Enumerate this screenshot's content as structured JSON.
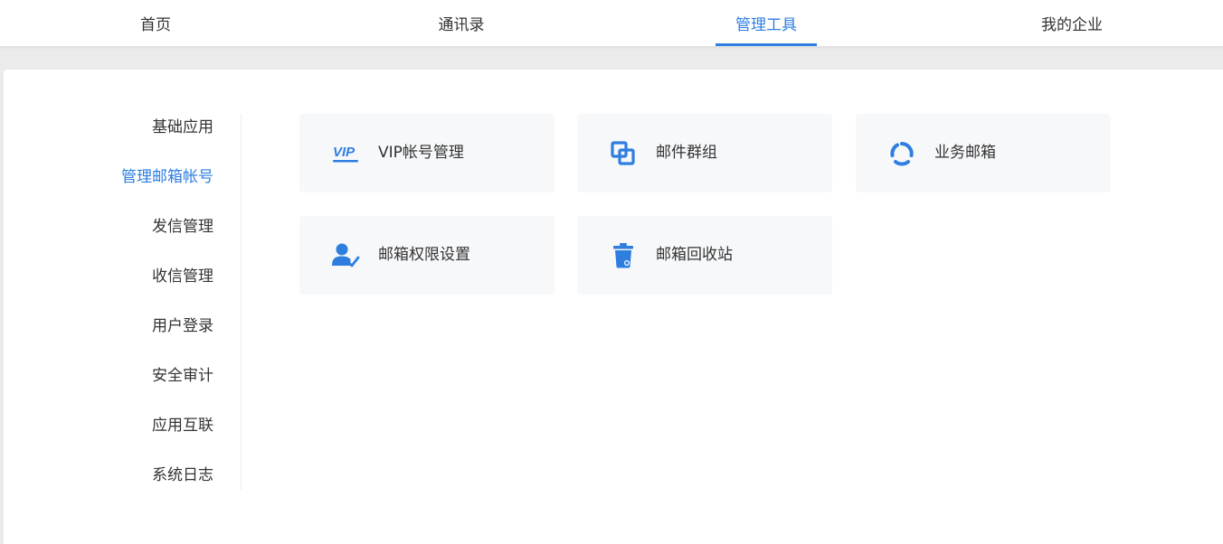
{
  "top_nav": {
    "tabs": [
      {
        "label": "首页",
        "active": false
      },
      {
        "label": "通讯录",
        "active": false
      },
      {
        "label": "管理工具",
        "active": true
      },
      {
        "label": "我的企业",
        "active": false
      }
    ]
  },
  "sidebar": {
    "items": [
      {
        "label": "基础应用",
        "active": false
      },
      {
        "label": "管理邮箱帐号",
        "active": true
      },
      {
        "label": "发信管理",
        "active": false
      },
      {
        "label": "收信管理",
        "active": false
      },
      {
        "label": "用户登录",
        "active": false
      },
      {
        "label": "安全审计",
        "active": false
      },
      {
        "label": "应用互联",
        "active": false
      },
      {
        "label": "系统日志",
        "active": false
      }
    ]
  },
  "cards": [
    {
      "label": "VIP帐号管理",
      "icon": "vip-icon"
    },
    {
      "label": "邮件群组",
      "icon": "mail-group-icon"
    },
    {
      "label": "业务邮箱",
      "icon": "business-mailbox-icon"
    },
    {
      "label": "邮箱权限设置",
      "icon": "user-permission-icon"
    },
    {
      "label": "邮箱回收站",
      "icon": "trash-bin-icon"
    }
  ],
  "colors": {
    "accent": "#2e7ee0",
    "text": "#333333",
    "card_bg": "#f7f8fa",
    "page_bg": "#ebebeb"
  }
}
